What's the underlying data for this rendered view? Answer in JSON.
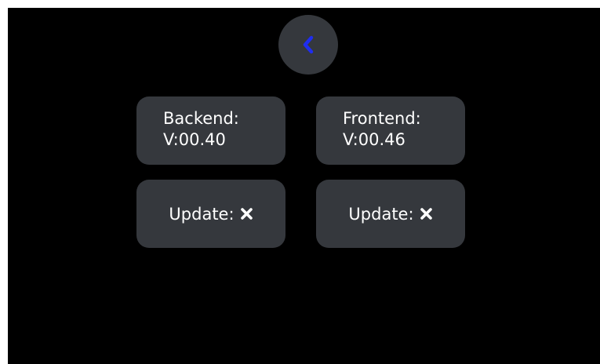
{
  "back_button": {
    "icon": "chevron-left-icon",
    "icon_color": "#1f2df0"
  },
  "backend": {
    "title": "Backend:",
    "version": "V:00.40",
    "update_label": "Update:",
    "update_icon": "x-icon"
  },
  "frontend": {
    "title": "Frontend:",
    "version": "V:00.46",
    "update_label": "Update:",
    "update_icon": "x-icon"
  },
  "colors": {
    "background": "#000000",
    "card": "#35383d",
    "text": "#ffffff",
    "accent": "#1f2df0"
  }
}
